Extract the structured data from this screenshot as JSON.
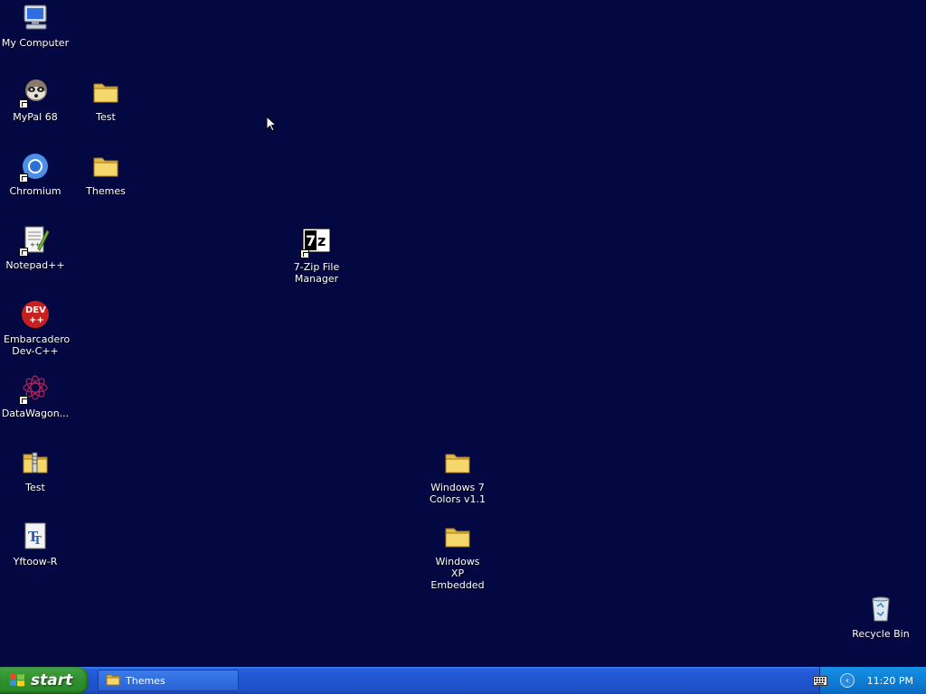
{
  "desktop": {
    "icons": [
      {
        "label": "My Computer",
        "icon": "computer-icon"
      },
      {
        "label": "MyPal 68",
        "icon": "raccoon-browser-icon"
      },
      {
        "label": "Test",
        "icon": "folder-icon"
      },
      {
        "label": "Chromium",
        "icon": "chromium-icon"
      },
      {
        "label": "Themes",
        "icon": "folder-icon"
      },
      {
        "label": "Notepad++",
        "icon": "notepad-plus-plus-icon"
      },
      {
        "label": "7-Zip File Manager",
        "icon": "seven-zip-icon"
      },
      {
        "label": "Embarcadero Dev-C++",
        "icon": "dev-cpp-icon"
      },
      {
        "label": "DataWagon...",
        "icon": "datawagon-icon"
      },
      {
        "label": "Test",
        "icon": "zip-folder-icon"
      },
      {
        "label": "Windows 7 Colors v1.1",
        "icon": "folder-icon"
      },
      {
        "label": "Yftoow-R",
        "icon": "font-file-icon"
      },
      {
        "label": "Windows XP Embedded",
        "icon": "folder-icon"
      },
      {
        "label": "Recycle Bin",
        "icon": "recycle-bin-icon"
      }
    ]
  },
  "taskbar": {
    "start_label": "start",
    "task_button_label": "Themes",
    "clock": "11:20 PM"
  },
  "colors": {
    "desktop_bg": "#030843",
    "taskbar_blue": "#245edb",
    "start_green": "#3c9d3b",
    "tray_blue": "#0e7fd4"
  }
}
